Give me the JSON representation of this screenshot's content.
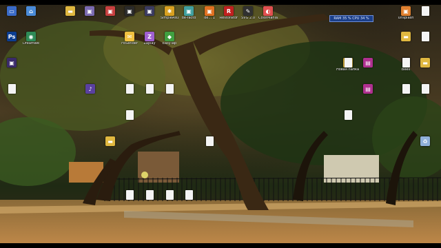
{
  "desktop": {
    "sysmon": "RAM 35 %  CPU 34 %",
    "icons": [
      {
        "label": "",
        "icon": "computer-icon",
        "color": "#3a6bc8",
        "glyph": "▭"
      },
      {
        "label": "",
        "icon": "network-icon",
        "color": "#4a8bd8",
        "glyph": "⌂"
      },
      {
        "label": "",
        "icon": "folder-icon",
        "color": "#e0b840",
        "glyph": "▬"
      },
      {
        "label": "",
        "icon": "app-icon",
        "color": "#7a6ab0",
        "glyph": "▣"
      },
      {
        "label": "",
        "icon": "app-icon",
        "color": "#c84040",
        "glyph": "▣"
      },
      {
        "label": "",
        "icon": "app-icon",
        "color": "#2a2a2a",
        "glyph": "▣"
      },
      {
        "label": "",
        "icon": "app-icon",
        "color": "#3a3a60",
        "glyph": "▣"
      },
      {
        "label": "SimpleAsu",
        "icon": "gear-icon",
        "color": "#d8a020",
        "glyph": "✱"
      },
      {
        "label": "de-facto",
        "icon": "app-icon",
        "color": "#40a0a0",
        "glyph": "▣"
      },
      {
        "label": "de... 1",
        "icon": "app-icon",
        "color": "#e07020",
        "glyph": "▣"
      },
      {
        "label": "Restorator",
        "icon": "res-icon",
        "color": "#c02020",
        "glyph": "R"
      },
      {
        "label": "SVG 2.0",
        "icon": "app-icon",
        "color": "#303030",
        "glyph": "✎"
      },
      {
        "label": "ColorMania",
        "icon": "palette-icon",
        "color": "#e05050",
        "glyph": "◐"
      },
      {
        "label": "Unsplash",
        "icon": "app-icon",
        "color": "#e08030",
        "glyph": "▣"
      },
      {
        "label": "",
        "icon": "document-icon",
        "color": "#f4f4f4",
        "glyph": ""
      },
      {
        "label": "",
        "icon": "photoshop-icon",
        "color": "#0b3d91",
        "glyph": "Ps"
      },
      {
        "label": "Dreamwe",
        "icon": "globe-icon",
        "color": "#2e8b57",
        "glyph": "◉"
      },
      {
        "label": "FbSender",
        "icon": "app-icon",
        "color": "#f0c040",
        "glyph": "✉"
      },
      {
        "label": "Zaplay",
        "icon": "app-icon",
        "color": "#a060d0",
        "glyph": "Z"
      },
      {
        "label": "EasyTap",
        "icon": "app-icon",
        "color": "#40a040",
        "glyph": "◆"
      },
      {
        "label": "",
        "icon": "folder-icon",
        "color": "#e0b840",
        "glyph": "▬"
      },
      {
        "label": "",
        "icon": "document-icon",
        "color": "#f4f4f4",
        "glyph": ""
      },
      {
        "label": "",
        "icon": "app-icon",
        "color": "#3a2a6a",
        "glyph": "▣"
      },
      {
        "label": "",
        "icon": "document-icon",
        "color": "#f4f4f4",
        "glyph": ""
      },
      {
        "label": "Новая папка dimash528",
        "icon": "folder-icon",
        "color": "#e0b840",
        "glyph": "▬"
      },
      {
        "label": "",
        "icon": "archive-icon",
        "color": "#b03090",
        "glyph": "▤"
      },
      {
        "label": "Bees",
        "icon": "document-icon",
        "color": "#f4f4f4",
        "glyph": ""
      },
      {
        "label": "",
        "icon": "folder-icon",
        "color": "#e0b840",
        "glyph": "▬"
      },
      {
        "label": "",
        "icon": "document-icon",
        "color": "#f4f4f4",
        "glyph": ""
      },
      {
        "label": "",
        "icon": "app-icon",
        "color": "#5a40a0",
        "glyph": "♪"
      },
      {
        "label": "",
        "icon": "document-icon",
        "color": "#f4f4f4",
        "glyph": ""
      },
      {
        "label": "",
        "icon": "document-icon",
        "color": "#f4f4f4",
        "glyph": ""
      },
      {
        "label": "",
        "icon": "document-icon",
        "color": "#f4f4f4",
        "glyph": ""
      },
      {
        "label": "",
        "icon": "document-icon",
        "color": "#f4f4f4",
        "glyph": ""
      },
      {
        "label": "",
        "icon": "document-icon",
        "color": "#f4f4f4",
        "glyph": ""
      },
      {
        "label": "",
        "icon": "document-icon",
        "color": "#f4f4f4",
        "glyph": ""
      },
      {
        "label": "",
        "icon": "archive-icon",
        "color": "#b03090",
        "glyph": "▤"
      },
      {
        "label": "",
        "icon": "document-icon",
        "color": "#f4f4f4",
        "glyph": ""
      },
      {
        "label": "",
        "icon": "folder-icon",
        "color": "#e0b840",
        "glyph": "▬"
      },
      {
        "label": "",
        "icon": "document-icon",
        "color": "#f4f4f4",
        "glyph": ""
      },
      {
        "label": "",
        "icon": "document-icon",
        "color": "#f4f4f4",
        "glyph": ""
      },
      {
        "label": "",
        "icon": "recycle-bin-icon",
        "color": "#8fb0d8",
        "glyph": "♻"
      },
      {
        "label": "",
        "icon": "document-icon",
        "color": "#f4f4f4",
        "glyph": ""
      },
      {
        "label": "",
        "icon": "document-icon",
        "color": "#f4f4f4",
        "glyph": ""
      },
      {
        "label": "",
        "icon": "document-icon",
        "color": "#f4f4f4",
        "glyph": ""
      },
      {
        "label": "",
        "icon": "document-icon",
        "color": "#f4f4f4",
        "glyph": ""
      },
      {
        "label": "",
        "icon": "document-icon",
        "color": "#f4f4f4",
        "glyph": ""
      }
    ]
  }
}
